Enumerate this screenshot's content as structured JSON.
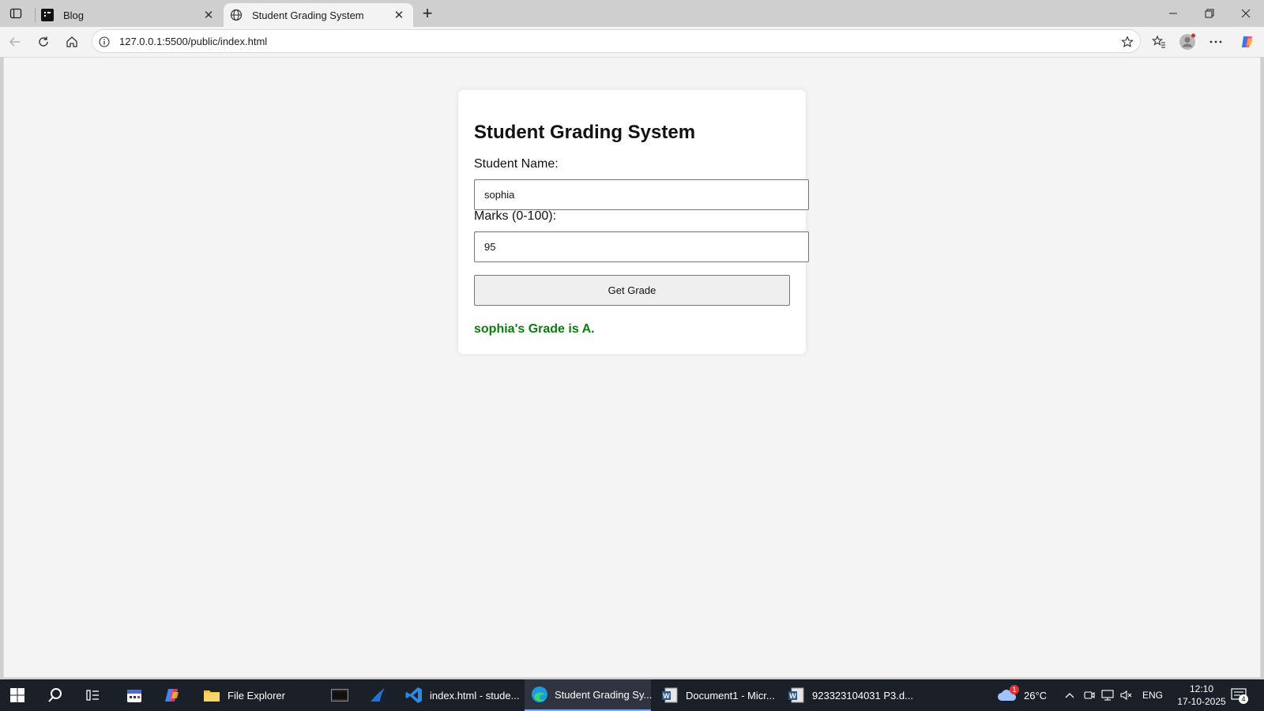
{
  "browser": {
    "tabs": [
      {
        "title": "Blog",
        "active": false
      },
      {
        "title": "Student Grading System",
        "active": true
      }
    ],
    "address": "127.0.0.1:5500/public/index.html"
  },
  "page": {
    "heading": "Student Grading System",
    "name_label": "Student Name:",
    "name_value": "sophia",
    "marks_label": "Marks (0-100):",
    "marks_value": "95",
    "button_label": "Get Grade",
    "result": "sophia's Grade is A.",
    "result_color": "#0a7d0a"
  },
  "taskbar": {
    "apps": [
      {
        "name": "File Explorer",
        "icon": "folder-icon"
      },
      {
        "name": "",
        "icon": "terminal-icon"
      },
      {
        "name": "",
        "icon": "shark-app-icon"
      },
      {
        "name": "index.html - stude...",
        "icon": "vscode-icon"
      },
      {
        "name": "Student Grading Sy...",
        "icon": "edge-icon",
        "active": true
      },
      {
        "name": "Document1 - Micr...",
        "icon": "word-icon"
      },
      {
        "name": "923323104031 P3.d...",
        "icon": "word-doc-icon"
      }
    ],
    "weather": "26°C",
    "weather_badge": "1",
    "language": "ENG",
    "time": "12:10",
    "date": "17-10-2025",
    "notification_count": "4"
  }
}
